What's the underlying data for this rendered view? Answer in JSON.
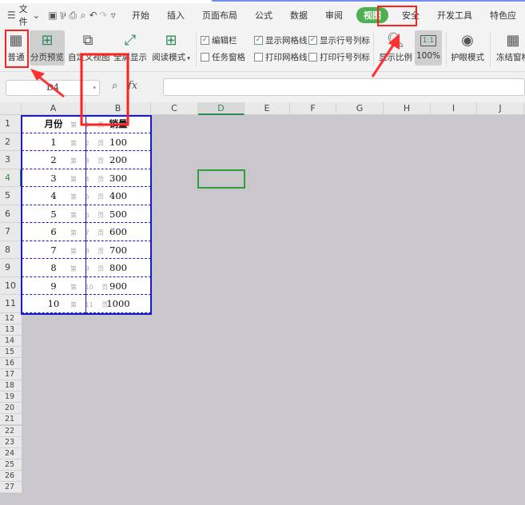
{
  "menu": {
    "file": "文件",
    "tabs": [
      "开始",
      "插入",
      "页面布局",
      "公式",
      "数据",
      "审阅",
      "视图",
      "安全",
      "开发工具",
      "特色应"
    ],
    "active_tab": "视图"
  },
  "ribbon": {
    "buttons": [
      {
        "label": "普通",
        "icon": "grid-icon"
      },
      {
        "label": "分页预览",
        "icon": "page-break-icon"
      },
      {
        "label": "自定义视图",
        "icon": "custom-view-icon"
      },
      {
        "label": "全屏显示",
        "icon": "fullscreen-icon"
      },
      {
        "label": "阅读模式",
        "icon": "reading-mode-icon"
      }
    ],
    "checks": [
      {
        "label": "编辑栏",
        "checked": true
      },
      {
        "label": "任务窗格",
        "checked": false
      },
      {
        "label": "显示网格线",
        "checked": true
      },
      {
        "label": "打印网格线",
        "checked": false
      },
      {
        "label": "显示行号列标",
        "checked": true
      },
      {
        "label": "打印行号列标",
        "checked": false
      }
    ],
    "zoom_label": "显示比例",
    "zoom_value": "100%",
    "zoom_icon_text": "1:1",
    "eye_label": "护眼模式",
    "freeze_label": "冻结窗格"
  },
  "formula_bar": {
    "name_box": "D4",
    "fx": "fx",
    "value": ""
  },
  "columns": [
    "A",
    "B",
    "C",
    "D",
    "E",
    "F",
    "G",
    "H",
    "I",
    "J"
  ],
  "rows": [
    "1",
    "2",
    "3",
    "4",
    "5",
    "6",
    "7",
    "8",
    "9",
    "10",
    "11",
    "12",
    "13",
    "14",
    "15",
    "16",
    "17",
    "18",
    "19",
    "20",
    "21",
    "22",
    "23",
    "24",
    "25",
    "26",
    "27"
  ],
  "table": {
    "headers": [
      "月份",
      "销量"
    ],
    "data": [
      [
        "1",
        "100"
      ],
      [
        "2",
        "200"
      ],
      [
        "3",
        "300"
      ],
      [
        "4",
        "400"
      ],
      [
        "5",
        "500"
      ],
      [
        "6",
        "600"
      ],
      [
        "7",
        "700"
      ],
      [
        "8",
        "800"
      ],
      [
        "9",
        "900"
      ],
      [
        "10",
        "1000"
      ]
    ]
  },
  "page_watermarks": [
    "第 1 页",
    "第 2 页",
    "第 3 页",
    "第 4 页",
    "第 5 页",
    "第 6 页",
    "第 7 页",
    "第 8 页",
    "第 9 页",
    "第 10 页",
    "第 11 页"
  ],
  "selected_cell": "D4",
  "colors": {
    "accent": "#4caf50",
    "page_border": "#1a1acc",
    "annotation": "#ff2020"
  }
}
